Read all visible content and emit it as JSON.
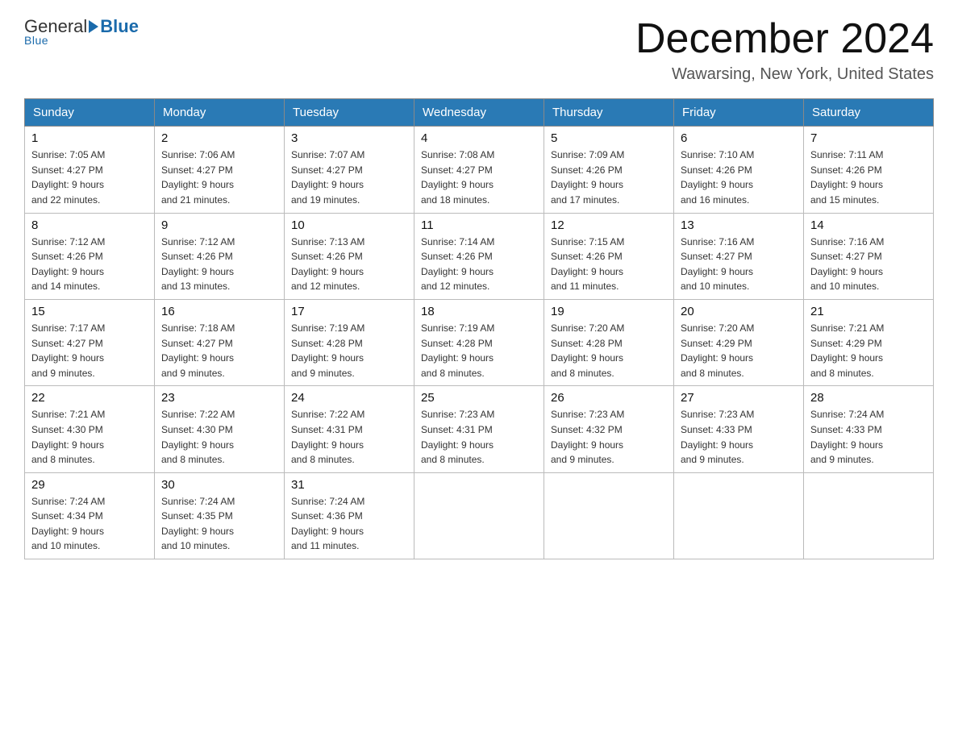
{
  "header": {
    "logo_general": "General",
    "logo_blue": "Blue",
    "month_title": "December 2024",
    "location": "Wawarsing, New York, United States"
  },
  "weekdays": [
    "Sunday",
    "Monday",
    "Tuesday",
    "Wednesday",
    "Thursday",
    "Friday",
    "Saturday"
  ],
  "weeks": [
    [
      {
        "day": "1",
        "sunrise": "7:05 AM",
        "sunset": "4:27 PM",
        "daylight": "9 hours and 22 minutes."
      },
      {
        "day": "2",
        "sunrise": "7:06 AM",
        "sunset": "4:27 PM",
        "daylight": "9 hours and 21 minutes."
      },
      {
        "day": "3",
        "sunrise": "7:07 AM",
        "sunset": "4:27 PM",
        "daylight": "9 hours and 19 minutes."
      },
      {
        "day": "4",
        "sunrise": "7:08 AM",
        "sunset": "4:27 PM",
        "daylight": "9 hours and 18 minutes."
      },
      {
        "day": "5",
        "sunrise": "7:09 AM",
        "sunset": "4:26 PM",
        "daylight": "9 hours and 17 minutes."
      },
      {
        "day": "6",
        "sunrise": "7:10 AM",
        "sunset": "4:26 PM",
        "daylight": "9 hours and 16 minutes."
      },
      {
        "day": "7",
        "sunrise": "7:11 AM",
        "sunset": "4:26 PM",
        "daylight": "9 hours and 15 minutes."
      }
    ],
    [
      {
        "day": "8",
        "sunrise": "7:12 AM",
        "sunset": "4:26 PM",
        "daylight": "9 hours and 14 minutes."
      },
      {
        "day": "9",
        "sunrise": "7:12 AM",
        "sunset": "4:26 PM",
        "daylight": "9 hours and 13 minutes."
      },
      {
        "day": "10",
        "sunrise": "7:13 AM",
        "sunset": "4:26 PM",
        "daylight": "9 hours and 12 minutes."
      },
      {
        "day": "11",
        "sunrise": "7:14 AM",
        "sunset": "4:26 PM",
        "daylight": "9 hours and 12 minutes."
      },
      {
        "day": "12",
        "sunrise": "7:15 AM",
        "sunset": "4:26 PM",
        "daylight": "9 hours and 11 minutes."
      },
      {
        "day": "13",
        "sunrise": "7:16 AM",
        "sunset": "4:27 PM",
        "daylight": "9 hours and 10 minutes."
      },
      {
        "day": "14",
        "sunrise": "7:16 AM",
        "sunset": "4:27 PM",
        "daylight": "9 hours and 10 minutes."
      }
    ],
    [
      {
        "day": "15",
        "sunrise": "7:17 AM",
        "sunset": "4:27 PM",
        "daylight": "9 hours and 9 minutes."
      },
      {
        "day": "16",
        "sunrise": "7:18 AM",
        "sunset": "4:27 PM",
        "daylight": "9 hours and 9 minutes."
      },
      {
        "day": "17",
        "sunrise": "7:19 AM",
        "sunset": "4:28 PM",
        "daylight": "9 hours and 9 minutes."
      },
      {
        "day": "18",
        "sunrise": "7:19 AM",
        "sunset": "4:28 PM",
        "daylight": "9 hours and 8 minutes."
      },
      {
        "day": "19",
        "sunrise": "7:20 AM",
        "sunset": "4:28 PM",
        "daylight": "9 hours and 8 minutes."
      },
      {
        "day": "20",
        "sunrise": "7:20 AM",
        "sunset": "4:29 PM",
        "daylight": "9 hours and 8 minutes."
      },
      {
        "day": "21",
        "sunrise": "7:21 AM",
        "sunset": "4:29 PM",
        "daylight": "9 hours and 8 minutes."
      }
    ],
    [
      {
        "day": "22",
        "sunrise": "7:21 AM",
        "sunset": "4:30 PM",
        "daylight": "9 hours and 8 minutes."
      },
      {
        "day": "23",
        "sunrise": "7:22 AM",
        "sunset": "4:30 PM",
        "daylight": "9 hours and 8 minutes."
      },
      {
        "day": "24",
        "sunrise": "7:22 AM",
        "sunset": "4:31 PM",
        "daylight": "9 hours and 8 minutes."
      },
      {
        "day": "25",
        "sunrise": "7:23 AM",
        "sunset": "4:31 PM",
        "daylight": "9 hours and 8 minutes."
      },
      {
        "day": "26",
        "sunrise": "7:23 AM",
        "sunset": "4:32 PM",
        "daylight": "9 hours and 9 minutes."
      },
      {
        "day": "27",
        "sunrise": "7:23 AM",
        "sunset": "4:33 PM",
        "daylight": "9 hours and 9 minutes."
      },
      {
        "day": "28",
        "sunrise": "7:24 AM",
        "sunset": "4:33 PM",
        "daylight": "9 hours and 9 minutes."
      }
    ],
    [
      {
        "day": "29",
        "sunrise": "7:24 AM",
        "sunset": "4:34 PM",
        "daylight": "9 hours and 10 minutes."
      },
      {
        "day": "30",
        "sunrise": "7:24 AM",
        "sunset": "4:35 PM",
        "daylight": "9 hours and 10 minutes."
      },
      {
        "day": "31",
        "sunrise": "7:24 AM",
        "sunset": "4:36 PM",
        "daylight": "9 hours and 11 minutes."
      },
      null,
      null,
      null,
      null
    ]
  ]
}
